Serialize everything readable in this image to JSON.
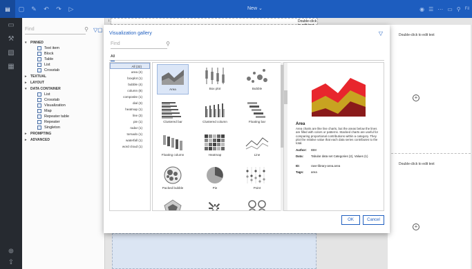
{
  "topbar": {
    "title": "New",
    "title_caret": "⌄",
    "right_label": "Fil"
  },
  "panel": {
    "search_placeholder": "Find",
    "groups": [
      {
        "label": "PINNED",
        "expanded": true,
        "items": [
          "Text item",
          "Block",
          "Table",
          "List",
          "Crosstab"
        ]
      },
      {
        "label": "TEXTUAL",
        "expanded": false,
        "items": []
      },
      {
        "label": "LAYOUT",
        "expanded": false,
        "items": []
      },
      {
        "label": "DATA CONTAINER",
        "expanded": true,
        "items": [
          "List",
          "Crosstab",
          "Visualization",
          "Map",
          "Repeater table",
          "Repeater",
          "Singleton"
        ]
      },
      {
        "label": "PROMPTING",
        "expanded": false,
        "items": []
      },
      {
        "label": "ADVANCED",
        "expanded": false,
        "items": []
      }
    ]
  },
  "report": {
    "top_label": "Double-click to edit text",
    "right_label_1": "Double-click to edit text",
    "right_label_2": "Double-click to edit text"
  },
  "gallery": {
    "title": "Visualization gallery",
    "search_placeholder": "Find",
    "tab": "All",
    "categories": [
      "All (32)",
      "area (4)",
      "boxplot (1)",
      "bubble (4)",
      "column (8)",
      "composite (1)",
      "dial (3)",
      "heatmap (1)",
      "line (3)",
      "pie (1)",
      "radar (1)",
      "tornado (1)",
      "waterfall (1)",
      "word cloud (1)"
    ],
    "tiles": [
      "Area",
      "Box plot",
      "Bubble",
      "Clustered bar",
      "Clustered column",
      "Floating bar",
      "Floating column",
      "Heatmap",
      "Line",
      "Packed bubble",
      "Pie",
      "Point",
      "Radar",
      "Radial",
      "Radial bar"
    ],
    "detail": {
      "name": "Area",
      "description": "Area charts are like line charts, but the areas below the lines are filled with colors or patterns. Stacked charts are useful for comparing proportional contributions within a category. They plot the relative value that each data series contributes to the total.",
      "author_key": "Author:",
      "author": "IBM",
      "data_key": "Data:",
      "data": "Tabular data set Categories (2), Values (1)",
      "id_key": "ID:",
      "id": "rave-library-area.area",
      "tags_key": "Tags:",
      "tags": "area"
    },
    "ok_label": "OK",
    "cancel_label": "Cancel"
  },
  "colors": {
    "brand": "#1d5dbf",
    "area_red": "#e8262d",
    "area_gold": "#c8a321",
    "area_dark": "#8a1a1a"
  }
}
